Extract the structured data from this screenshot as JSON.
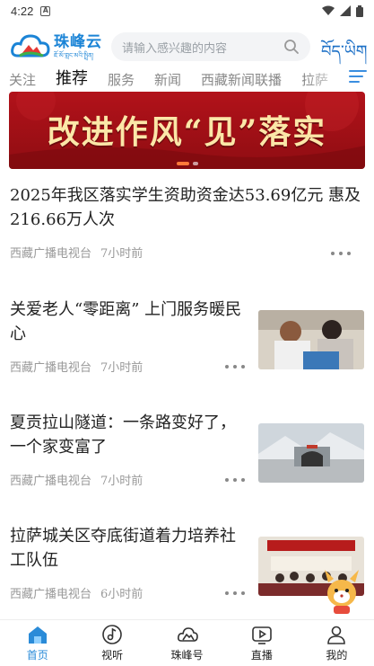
{
  "status_bar": {
    "time": "4:22",
    "left_icon": "A"
  },
  "header": {
    "logo_text": "珠峰云",
    "logo_sub": "ཇོ་མོ་གླང་མའི་སྤྲིན།",
    "search_placeholder": "请输入感兴趣的内容",
    "tibetan_title": "བོད་ཡིག"
  },
  "tabs": [
    "关注",
    "推荐",
    "服务",
    "新闻",
    "西藏新闻联播",
    "拉萨"
  ],
  "active_tab": "推荐",
  "banner": {
    "text": "改进作风“见”落实",
    "colors": {
      "bg": "#b2121a",
      "text": "#fbe7a8"
    }
  },
  "news": [
    {
      "title": "2025年我区落实学生资助资金达53.69亿元 惠及216.66万人次",
      "source": "西藏广播电视台",
      "time": "7小时前",
      "has_thumb": false
    },
    {
      "title": "关爱老人“零距离” 上门服务暖民心",
      "source": "西藏广播电视台",
      "time": "7小时前",
      "has_thumb": true
    },
    {
      "title": "夏贡拉山隧道：一条路变好了，一个家变富了",
      "source": "西藏广播电视台",
      "time": "7小时前",
      "has_thumb": true
    },
    {
      "title": "拉萨城关区夺底街道着力培养社工队伍",
      "source": "西藏广播电视台",
      "time": "6小时前",
      "has_thumb": true
    }
  ],
  "bottom_nav": [
    {
      "label": "首页",
      "icon": "home-icon",
      "active": true
    },
    {
      "label": "视听",
      "icon": "music-note-icon",
      "active": false
    },
    {
      "label": "珠峰号",
      "icon": "mountain-cloud-icon",
      "active": false
    },
    {
      "label": "直播",
      "icon": "play-screen-icon",
      "active": false
    },
    {
      "label": "我的",
      "icon": "user-icon",
      "active": false
    }
  ],
  "accent_color": "#2a8bd8"
}
